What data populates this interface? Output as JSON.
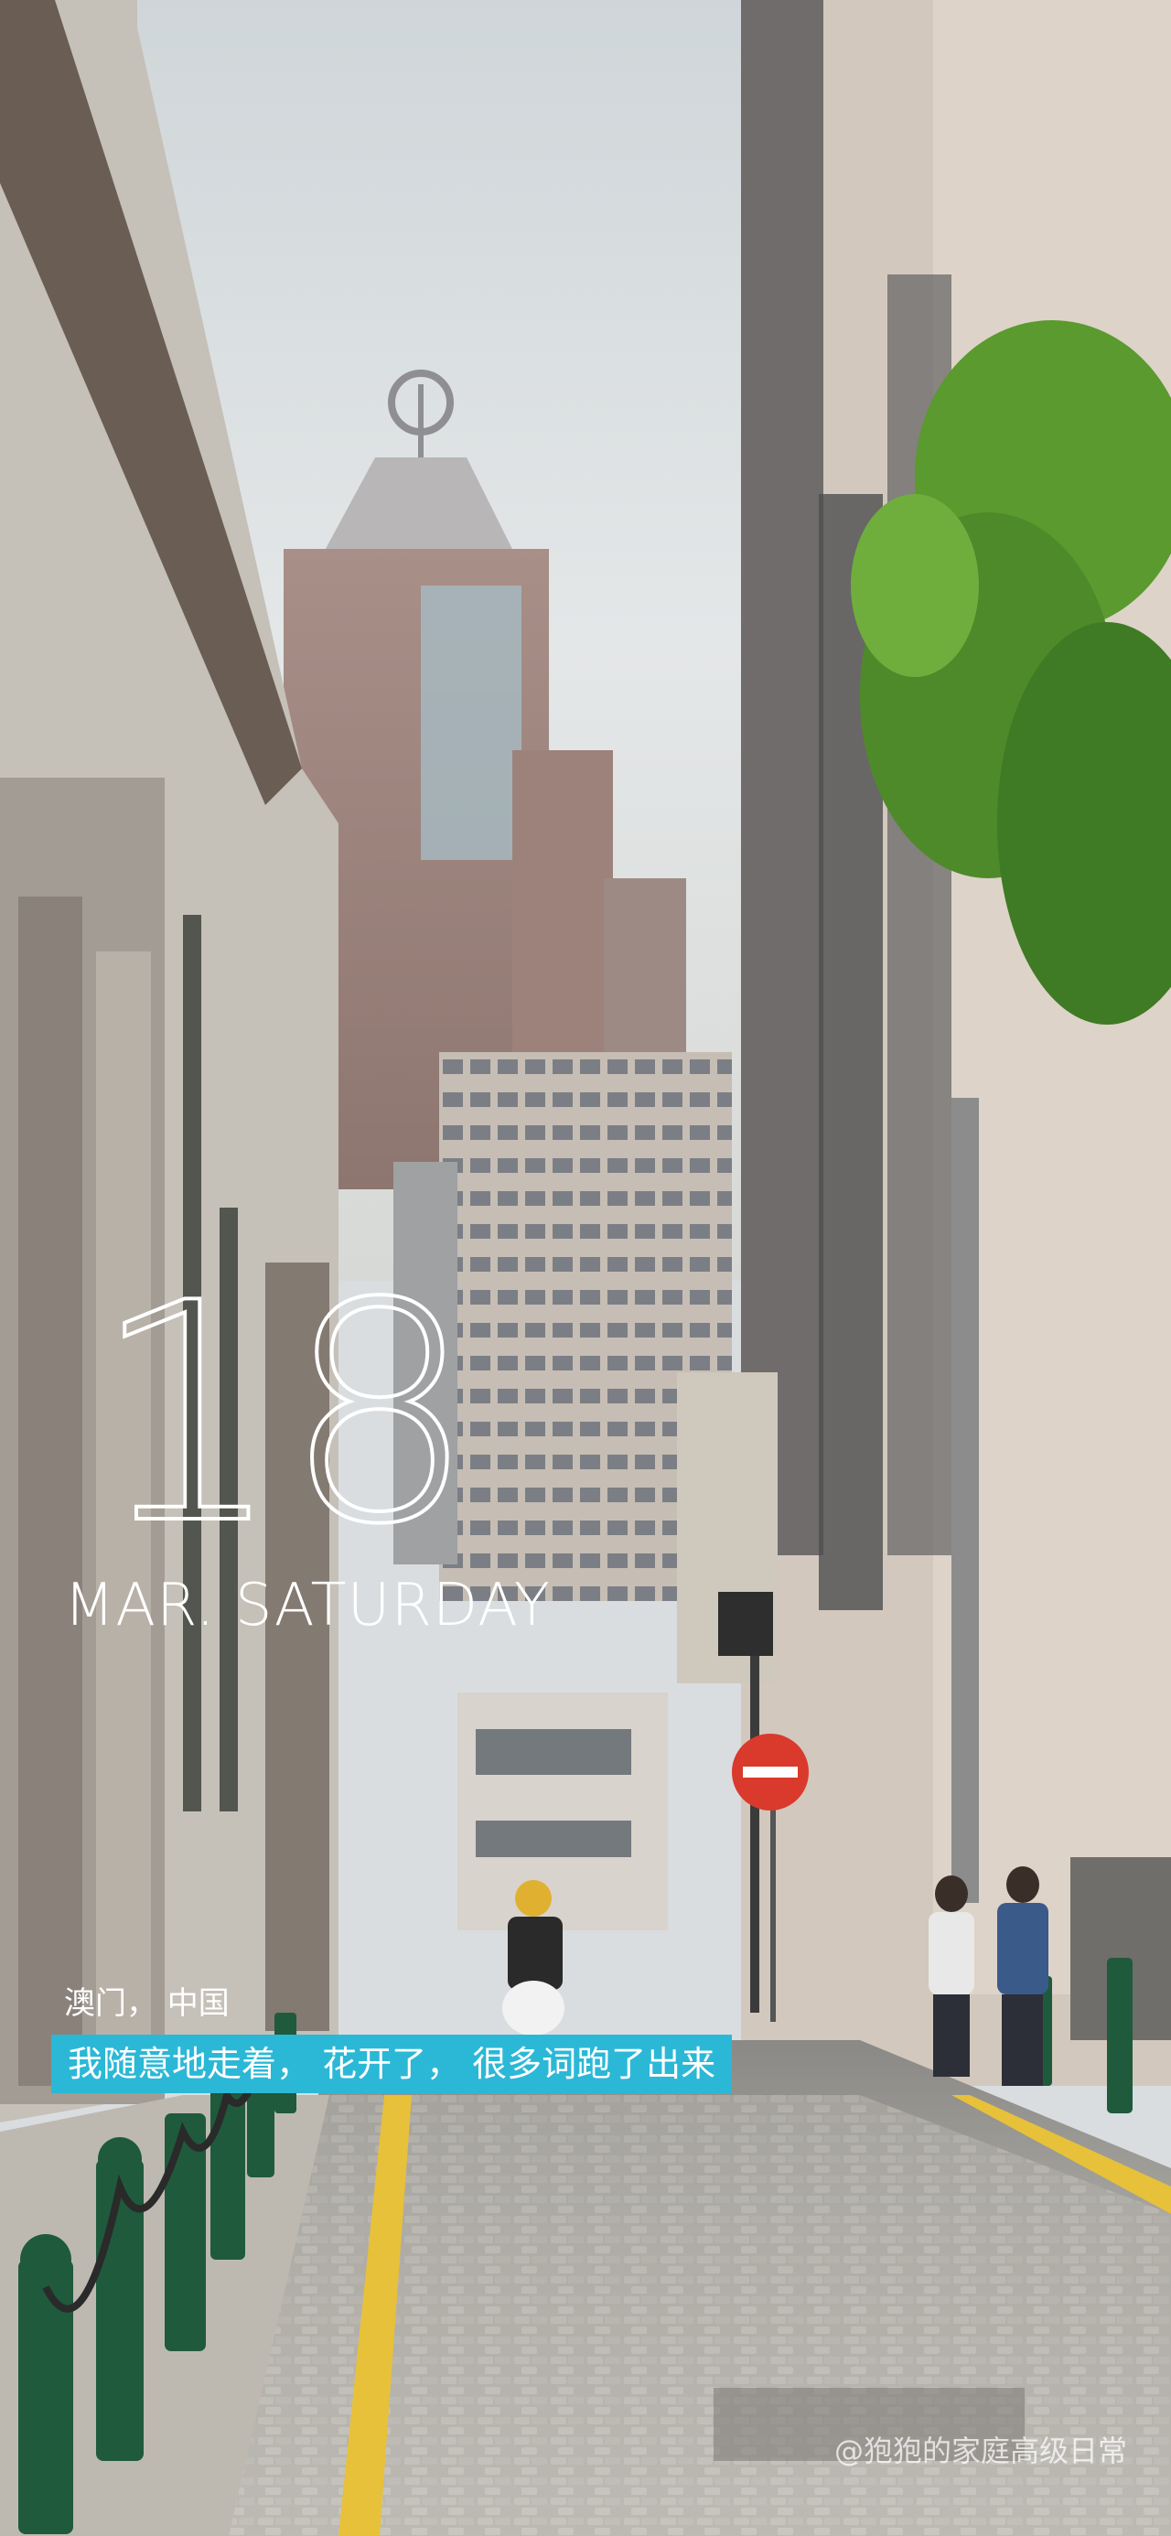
{
  "date": {
    "day": "18",
    "month_weekday": "MAR. SATURDAY"
  },
  "location": "澳门， 中国",
  "quote": "我随意地走着， 花开了， 很多词跑了出来",
  "watermark": "@狍狍的家庭高级日常",
  "colors": {
    "sky": "#dfe4e6",
    "quote_band": "#2bb8d6",
    "no_entry_sign": "#d93a2b",
    "tree": "#4e8a2a",
    "curb_line": "#e7c13a"
  }
}
